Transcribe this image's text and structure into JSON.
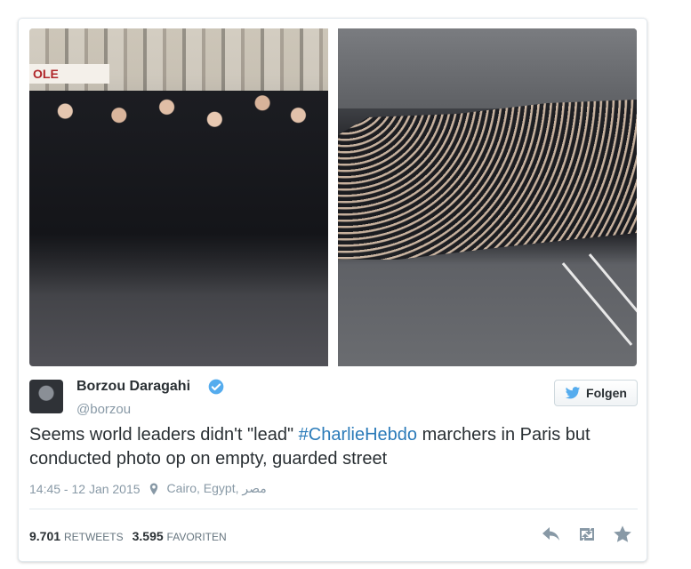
{
  "photos": {
    "left_sign_text": "OLE"
  },
  "author": {
    "name": "Borzou Daragahi",
    "handle": "@borzou"
  },
  "follow_button": {
    "label": "Folgen"
  },
  "tweet": {
    "text_part1": "Seems world leaders didn't \"lead\" ",
    "hashtag": "#CharlieHebdo",
    "text_part2": " marchers in Paris but conducted photo op on empty, guarded street"
  },
  "meta": {
    "time": "14:45 - 12 Jan 2015",
    "location": "Cairo, Egypt, مصر"
  },
  "stats": {
    "retweets_count": "9.701",
    "retweets_label": "Retweets",
    "favorites_count": "3.595",
    "favorites_label": "Favoriten"
  },
  "colors": {
    "link": "#2b7bb9",
    "verified": "#55acee",
    "twitter_bird": "#55acee"
  }
}
